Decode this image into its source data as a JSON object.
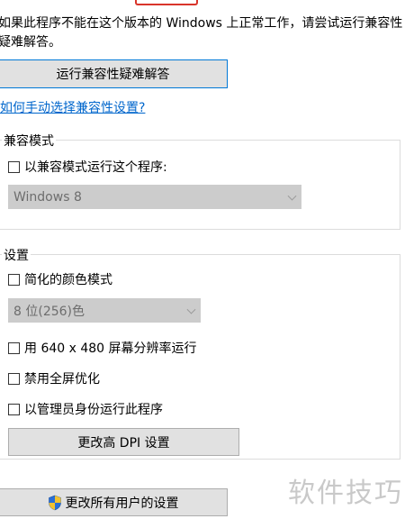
{
  "description": "如果此程序不能在这个版本的 Windows 上正常工作，请尝试运行兼容性疑难解答。",
  "troubleshooter_button": "运行兼容性疑难解答",
  "manual_link": "如何手动选择兼容性设置?",
  "compat_group": {
    "title": "兼容模式",
    "checkbox_label": "以兼容模式运行这个程序:",
    "os_select_value": "Windows 8"
  },
  "settings_group": {
    "title": "设置",
    "reduced_color_label": "简化的颜色模式",
    "color_select_value": "8 位(256)色",
    "resolution_label": "用 640 x 480 屏幕分辨率运行",
    "disable_fullscreen_label": "禁用全屏优化",
    "run_as_admin_label": "以管理员身份运行此程序",
    "dpi_button": "更改高 DPI 设置"
  },
  "all_users_button": "更改所有用户的设置",
  "watermark": "软件技巧",
  "colors": {
    "link": "#0066cc",
    "highlight": "#d9352b",
    "button_face": "#e1e1e1",
    "disabled_select": "#cccccc"
  },
  "icons": {
    "all_users_button": "uac-shield-icon"
  }
}
